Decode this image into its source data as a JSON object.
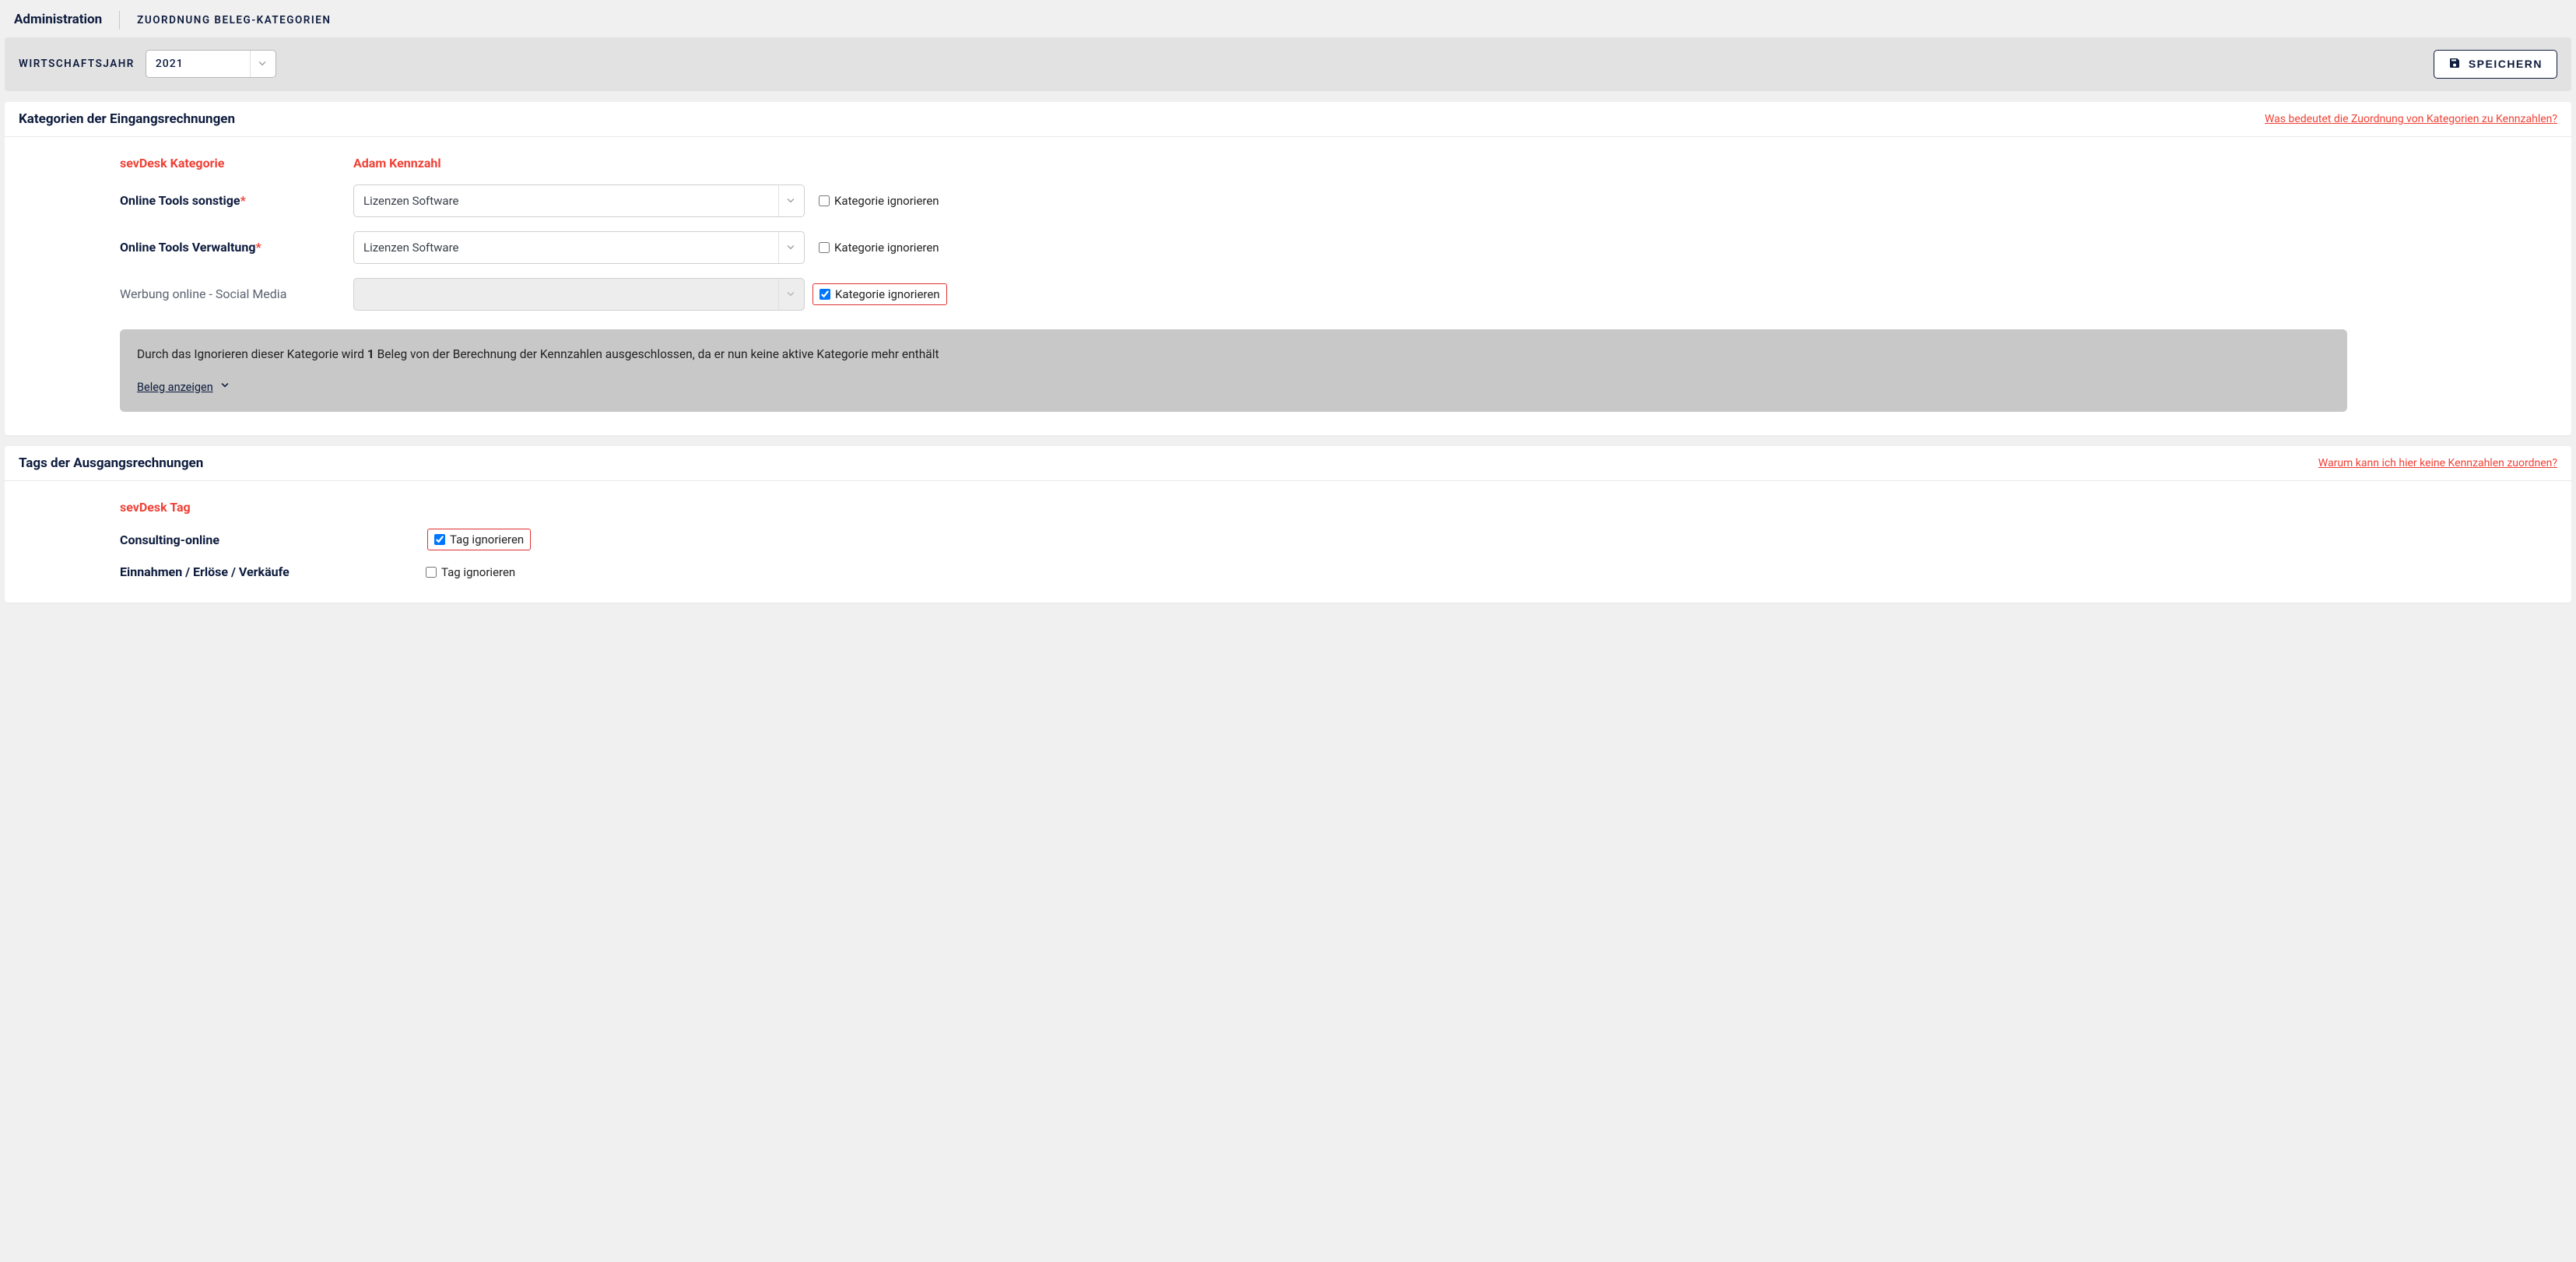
{
  "header": {
    "title": "Administration",
    "subtitle": "ZUORDNUNG BELEG-KATEGORIEN"
  },
  "toolbar": {
    "year_label": "WIRTSCHAFTSJAHR",
    "year_value": "2021",
    "save_label": "SPEICHERN"
  },
  "panel1": {
    "title": "Kategorien der Eingangsrechnungen",
    "help": "Was bedeutet die Zuordnung von Kategorien zu Kennzahlen?",
    "col1": "sevDesk Kategorie",
    "col2": "Adam Kennzahl",
    "rows": [
      {
        "label": "Online Tools sonstige",
        "required": true,
        "value": "Lizenzen Software",
        "ignore_label": "Kategorie ignorieren",
        "ignored": false,
        "disabled": false,
        "highlight": false
      },
      {
        "label": "Online Tools Verwaltung",
        "required": true,
        "value": "Lizenzen Software",
        "ignore_label": "Kategorie ignorieren",
        "ignored": false,
        "disabled": false,
        "highlight": false
      },
      {
        "label": "Werbung online - Social Media",
        "required": false,
        "value": "",
        "ignore_label": "Kategorie ignorieren",
        "ignored": true,
        "disabled": true,
        "highlight": true
      }
    ],
    "info_pre": "Durch das Ignorieren dieser Kategorie wird ",
    "info_bold": "1",
    "info_post": " Beleg von der Berechnung der Kennzahlen ausgeschlossen, da er nun keine aktive Kategorie mehr enthält",
    "info_link": "Beleg anzeigen"
  },
  "panel2": {
    "title": "Tags der Ausgangsrechnungen",
    "help": "Warum kann ich hier keine Kennzahlen zuordnen?",
    "col1": "sevDesk Tag",
    "rows": [
      {
        "label": "Consulting-online",
        "ignore_label": "Tag ignorieren",
        "ignored": true,
        "highlight": true
      },
      {
        "label": "Einnahmen / Erlöse / Verkäufe",
        "ignore_label": "Tag ignorieren",
        "ignored": false,
        "highlight": false
      }
    ]
  }
}
